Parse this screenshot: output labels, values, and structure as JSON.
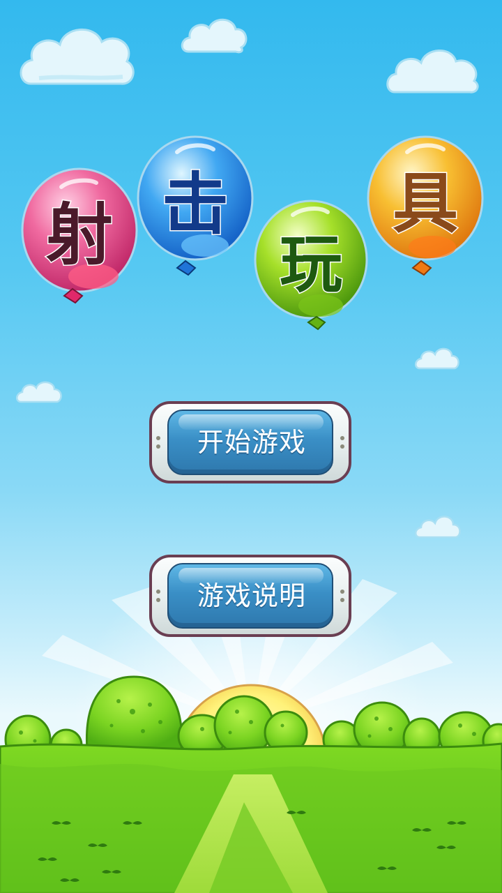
{
  "title": {
    "chars": [
      {
        "text": "射",
        "color": "#e8508a",
        "text_color": "#4a1a2a",
        "icon": "balloon-pink"
      },
      {
        "text": "击",
        "color": "#2f8fe8",
        "text_color": "#123a8a",
        "icon": "balloon-blue"
      },
      {
        "text": "玩",
        "color": "#8fd11e",
        "text_color": "#1e5a10",
        "icon": "balloon-green"
      },
      {
        "text": "具",
        "color": "#f4a92a",
        "text_color": "#8a4a1a",
        "icon": "balloon-orange"
      }
    ]
  },
  "menu": {
    "start_label": "开始游戏",
    "help_label": "游戏说明"
  },
  "colors": {
    "sky_top": "#33b9ee",
    "sky_bottom": "#eaf9fd",
    "grass": "#6fd01c",
    "button_blue": "#3a8fc6",
    "button_frame": "#6a3e52",
    "sun": "#fff176"
  }
}
